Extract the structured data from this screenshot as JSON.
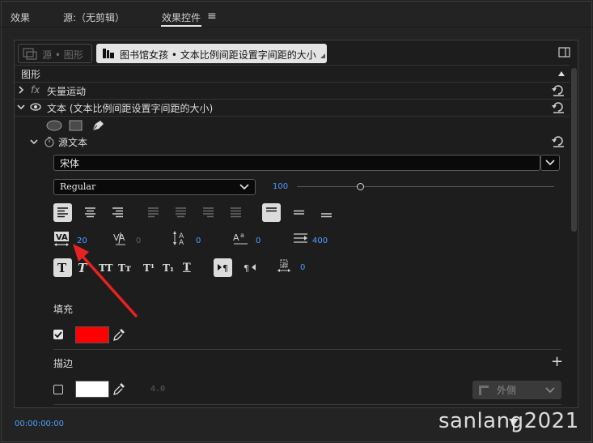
{
  "tabs": {
    "effects": "效果",
    "source": "源:（无剪辑）",
    "effect_controls": "效果控件",
    "menu_glyph": "≡"
  },
  "source_bar": {
    "inactive_label": "源 • 图形",
    "active_label": "图书馆女孩 • 文本比例间距设置字间距的大小"
  },
  "sections": {
    "graphics": "图形",
    "vector_motion": "矢量运动",
    "fx_glyph": "fx",
    "text_layer": "文本 (文本比例间距设置字间距的大小)",
    "source_text": "源文本"
  },
  "font": {
    "family": "宋体",
    "style": "Regular",
    "size": "100"
  },
  "text_values": {
    "tracking": "20",
    "kerning": "0",
    "leading": "0",
    "baseline_shift": "0",
    "tab_width": "400",
    "tsume": "0"
  },
  "fill": {
    "label": "填充",
    "color": "#ff0000",
    "checked": true
  },
  "stroke": {
    "label": "描边",
    "color": "#ffffff",
    "width": "4.0",
    "position": "外侧",
    "checked": false,
    "add_glyph": "+"
  },
  "footer": {
    "timecode": "00:00:00:00",
    "watermark": "sanlang2021"
  },
  "colors": {
    "accent": "#4a9eff",
    "arrow": "#e8231f"
  }
}
